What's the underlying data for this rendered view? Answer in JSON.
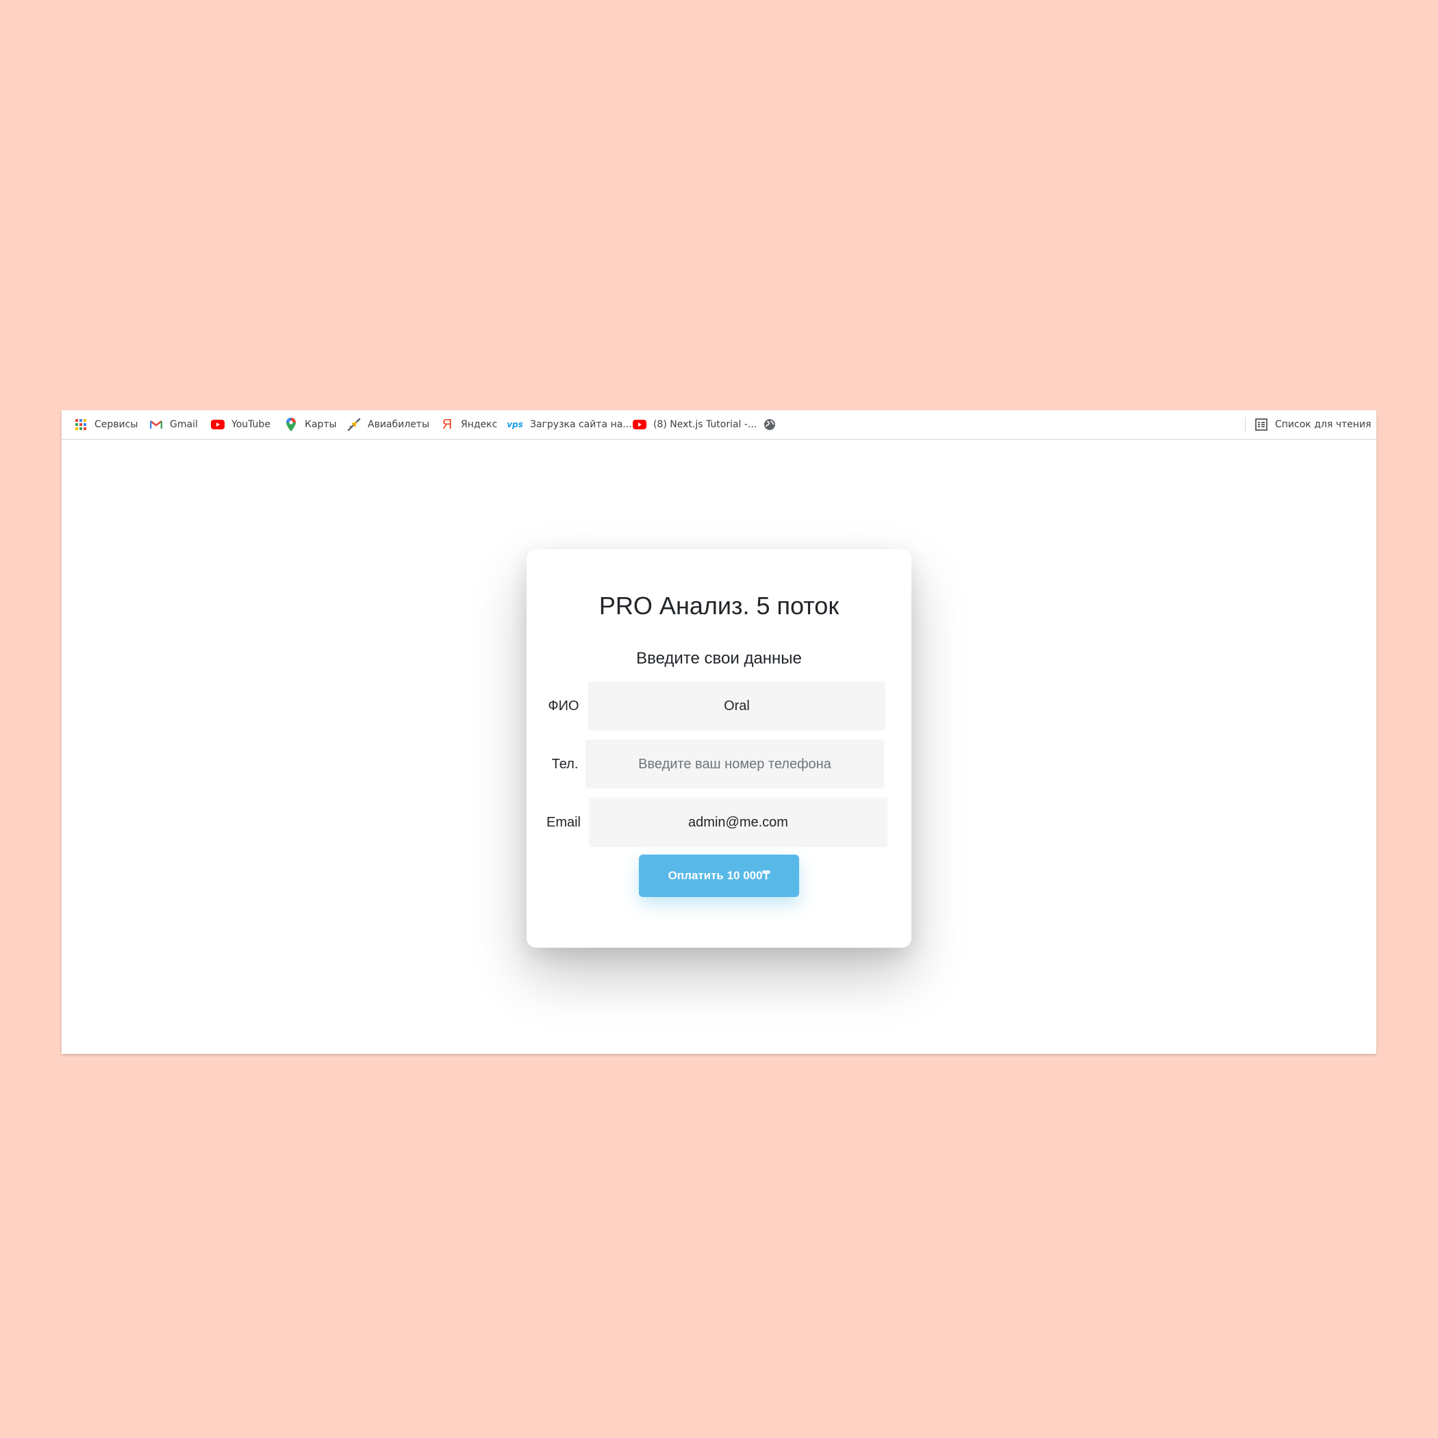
{
  "bookmarks_bar": {
    "items": [
      {
        "label": "Сервисы",
        "icon": "apps-grid-icon"
      },
      {
        "label": "Gmail",
        "icon": "gmail-icon"
      },
      {
        "label": "YouTube",
        "icon": "youtube-icon"
      },
      {
        "label": "Карты",
        "icon": "maps-pin-icon"
      },
      {
        "label": "Авиабилеты",
        "icon": "airplane-icon"
      },
      {
        "label": "Яндекс",
        "icon": "yandex-icon"
      },
      {
        "label": "Загрузка сайта на...",
        "icon": "vps-icon",
        "icon_text": "vps"
      },
      {
        "label": "(8) Next.js Tutorial -...",
        "icon": "youtube-icon"
      },
      {
        "label": "",
        "icon": "globe-icon"
      }
    ],
    "reading_list": {
      "label": "Список для чтения",
      "icon": "reading-list-icon"
    }
  },
  "form": {
    "title": "PRO Анализ. 5 поток",
    "subtitle": "Введите свои данные",
    "fields": {
      "name": {
        "label": "ФИО",
        "value": "Oral",
        "placeholder": ""
      },
      "phone": {
        "label": "Тел.",
        "value": "",
        "placeholder": "Введите ваш номер телефона"
      },
      "email": {
        "label": "Email",
        "value": "admin@me.com",
        "placeholder": ""
      }
    },
    "pay_button": "Оплатить 10 000₸"
  },
  "colors": {
    "background": "#fed3c4",
    "button": "#58b9e8",
    "input_bg": "#f5f5f5",
    "text": "#212529"
  }
}
